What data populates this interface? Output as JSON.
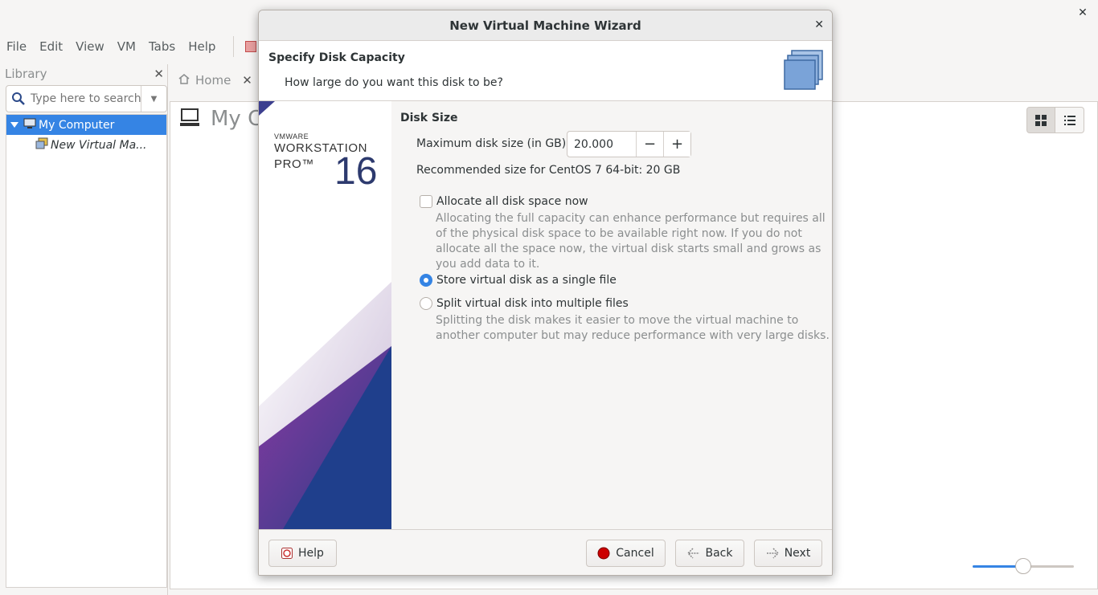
{
  "app": {
    "menu": [
      "File",
      "Edit",
      "View",
      "VM",
      "Tabs",
      "Help"
    ],
    "library": {
      "title": "Library",
      "search_placeholder": "Type here to search",
      "tree": [
        {
          "label": "My Computer",
          "selected": true
        },
        {
          "label": "New Virtual Ma..."
        }
      ]
    },
    "tabs": [
      {
        "label": "Home"
      }
    ],
    "content_title": "My Co",
    "zoom_level_fraction": 0.5
  },
  "dialog": {
    "title": "New Virtual Machine Wizard",
    "heading": "Specify Disk Capacity",
    "subheading": "How large do you want this disk to be?",
    "brand": {
      "vendor": "VMWARE",
      "product_line1": "WORKSTATION",
      "product_line2": "PRO™",
      "version": "16"
    },
    "section_title": "Disk Size",
    "max_size_label": "Maximum disk size (in GB):",
    "max_size_value": "20.000",
    "minus": "−",
    "plus": "+",
    "recommended": "Recommended size for CentOS 7 64-bit: 20 GB",
    "allocate_label": "Allocate all disk space now",
    "allocate_checked": false,
    "allocate_desc": "Allocating the full capacity can enhance performance but requires all of the physical disk space to be available right now. If you do not allocate all the space now, the virtual disk starts small and grows as you add data to it.",
    "single_file_label": "Store virtual disk as a single file",
    "split_label": "Split virtual disk into multiple files",
    "split_desc": "Splitting the disk makes it easier to move the virtual machine to another computer but may reduce performance with very large disks.",
    "selected_option": "single_file",
    "buttons": {
      "help": "Help",
      "cancel": "Cancel",
      "back": "Back",
      "next": "Next"
    },
    "colors": {
      "accent": "#3584e4",
      "cancel_icon": "#cc0000"
    }
  }
}
